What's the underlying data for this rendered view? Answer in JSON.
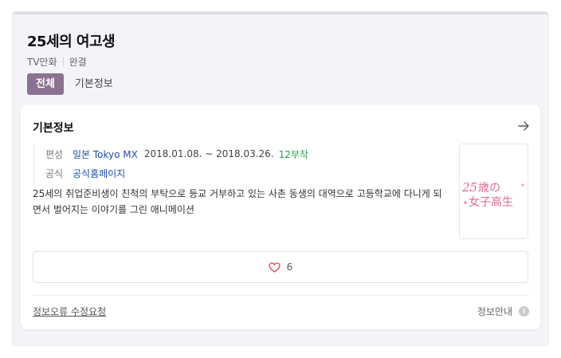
{
  "header": {
    "title": "25세의 여고생",
    "meta": [
      "TV만화",
      "완결"
    ]
  },
  "tabs": [
    {
      "label": "전체",
      "active": true
    },
    {
      "label": "기본정보",
      "active": false
    }
  ],
  "basic_info": {
    "section_title": "기본정보",
    "rows": [
      {
        "label": "편성",
        "broadcaster": "일본 Tokyo MX",
        "period": "2018.01.08. ~ 2018.03.26.",
        "episodes": "12부작"
      },
      {
        "label": "공식",
        "link": "공식홈페이지"
      }
    ],
    "description": "25세의 취업준비생이 친척의 부탁으로 등교 거부하고 있는 사촌 동생의 대역으로 고등학교에 다니게 되면서 벌어지는 이야기를 그린 애니메이션",
    "thumbnail_logo": "25歳の女子高生"
  },
  "like": {
    "count": "6"
  },
  "footer": {
    "report_label": "정보오류 수정요청",
    "guide_label": "정보안내",
    "guide_icon_glyph": "i"
  },
  "colors": {
    "accent": "#8a7290",
    "link": "#1e4fa8",
    "episodes": "#2ea14b",
    "heart": "#e0454f",
    "logo_pink": "#e06a8e"
  }
}
